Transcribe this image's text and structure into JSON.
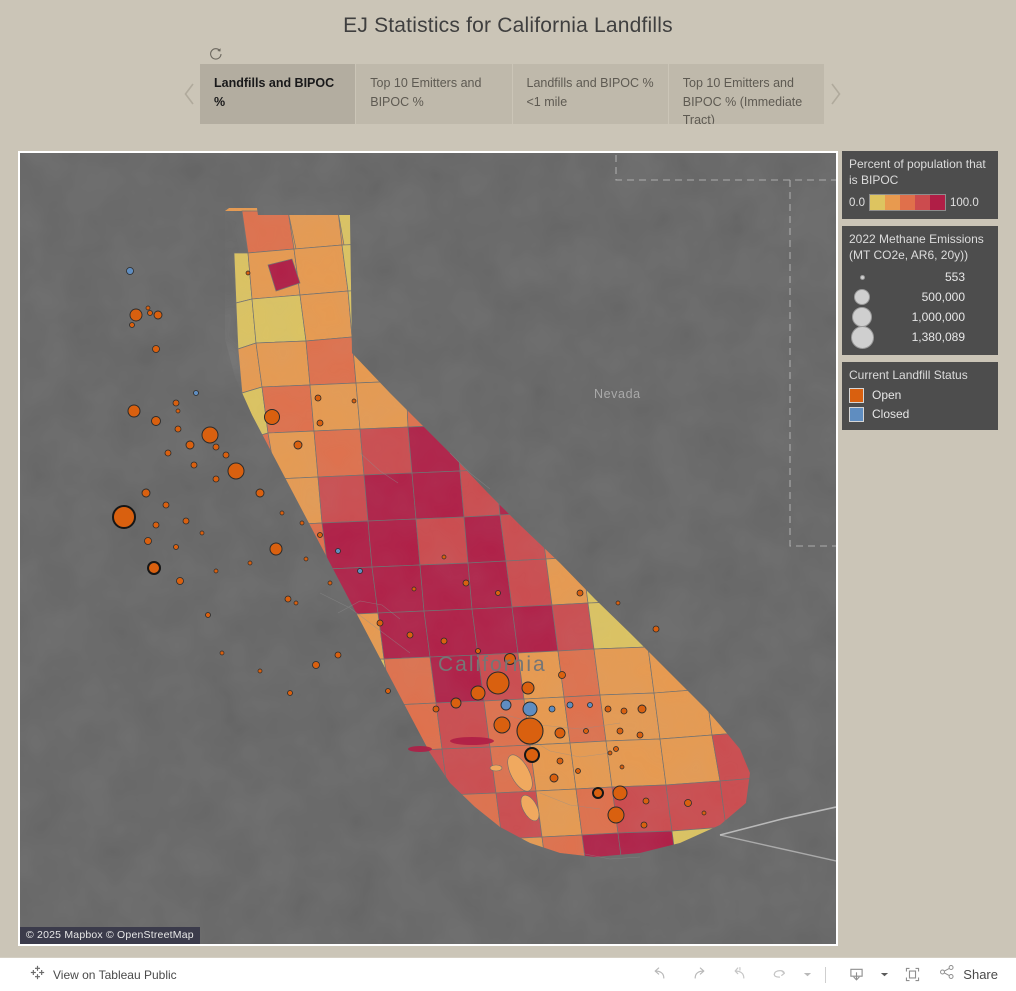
{
  "header": {
    "title": "EJ Statistics for California Landfills"
  },
  "tabstrip": {
    "reset_icon": "reset-icon",
    "prev_label": "‹",
    "next_label": "›",
    "tabs": [
      {
        "label": "Landfills and BIPOC %",
        "active": true
      },
      {
        "label": "Top 10 Emitters and BIPOC %",
        "active": false
      },
      {
        "label": "Landfills and BIPOC % <1 mile",
        "active": false
      },
      {
        "label": "Top 10 Emitters and BIPOC % (Immediate Tract)",
        "active": false
      }
    ]
  },
  "map": {
    "state_labels": [
      {
        "name": "Nevada"
      },
      {
        "name": "California"
      }
    ],
    "attribution": "© 2025 Mapbox  © OpenStreetMap",
    "background_color": "#676767",
    "water_color": "#707070"
  },
  "legends": {
    "choropleth": {
      "title": "Percent of population that is BIPOC",
      "min": "0.0",
      "max": "100.0",
      "colors": [
        "#ddc460",
        "#e89a4f",
        "#e0704b",
        "#cc4b4e",
        "#b01e46"
      ]
    },
    "size": {
      "title": "2022 Methane Emissions (MT CO2e, AR6, 20y))",
      "items": [
        {
          "label": "553",
          "d": 4
        },
        {
          "label": "500,000",
          "d": 14
        },
        {
          "label": "1,000,000",
          "d": 18
        },
        {
          "label": "1,380,089",
          "d": 21
        }
      ]
    },
    "status": {
      "title": "Current Landfill Status",
      "items": [
        {
          "label": "Open",
          "color": "#d9600f"
        },
        {
          "label": "Closed",
          "color": "#5f8dc0"
        }
      ]
    }
  },
  "toolbar": {
    "tableau_public_label": "View on Tableau Public",
    "share_label": "Share",
    "buttons": [
      {
        "name": "undo-button"
      },
      {
        "name": "redo-button"
      },
      {
        "name": "revert-button"
      },
      {
        "name": "refresh-button"
      },
      {
        "name": "pause-button"
      },
      {
        "name": "download-button"
      },
      {
        "name": "fullscreen-button"
      }
    ]
  },
  "chart_data": {
    "type": "map",
    "title": "EJ Statistics for California Landfills",
    "projection": "web-mercator",
    "basemap": "mapbox-dark",
    "choropleth": {
      "measure": "Percent of population that is BIPOC",
      "unit": "percent",
      "domain": [
        0.0,
        100.0
      ],
      "geography": "census tracts",
      "palette": [
        "#ddc460",
        "#e89a4f",
        "#e0704b",
        "#cc4b4e",
        "#b01e46"
      ]
    },
    "bubbles": {
      "measure": "2022 Methane Emissions (MT CO2e, AR6, 20y)",
      "size_breaks": [
        553,
        500000,
        1000000,
        1380089
      ],
      "color_field": "Current Landfill Status",
      "color_map": {
        "Open": "#d9600f",
        "Closed": "#5f8dc0"
      },
      "count_visible_open": 118,
      "count_visible_closed": 16
    },
    "extent_states": [
      "California",
      "Nevada"
    ],
    "legend_position": "right"
  }
}
